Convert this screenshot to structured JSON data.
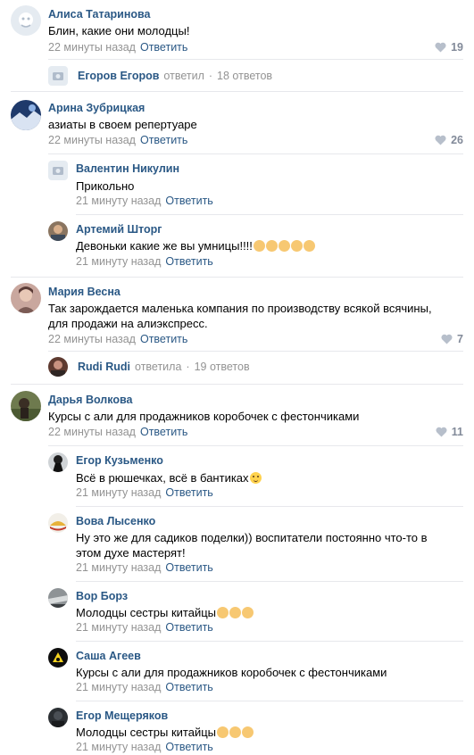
{
  "reply_label": "Ответить",
  "colors": {
    "link": "#2a5885",
    "meta": "#939393",
    "likes": "#828a99",
    "divider": "#e7e8ec"
  },
  "comments": [
    {
      "name": "Алиса Татаринова",
      "text": "Блин, какие они молодцы!",
      "time": "22 минуты назад",
      "likes": "19"
    },
    {
      "name": "Арина Зубрицкая",
      "text": "азиаты в своем репертуаре",
      "time": "22 минуты назад",
      "likes": "26"
    },
    {
      "name": "Мария Весна",
      "text": "Так зарождается маленька компания по производству всякой всячины, для продажи на алиэкспресс.",
      "time": "22 минуты назад",
      "likes": "7"
    },
    {
      "name": "Дарья Волкова",
      "text": "Курсы с али для продажников коробочек с фестончиками",
      "time": "22 минуты назад",
      "likes": "11"
    }
  ],
  "replies": [
    {
      "name": "Валентин Никулин",
      "text": "Прикольно",
      "time": "21 минуту назад"
    },
    {
      "name": "Артемий Шторг",
      "text": "Девоньки какие же вы умницы!!!!",
      "time": "21 минуту назад",
      "emoji": "clapping-hands"
    },
    {
      "name": "Егор Кузьменко",
      "text": "Всё в рюшечках, всё в бантиках",
      "time": "21 минуту назад",
      "emoji": "smiling-face"
    },
    {
      "name": "Вова Лысенко",
      "text": "Ну это же для садиков поделки)) воспитатели постоянно что-то в этом духе мастерят!",
      "time": "21 минуту назад"
    },
    {
      "name": "Вор Борз",
      "text": "Молодцы сестры китайцы",
      "time": "21 минуту назад",
      "emoji": "thumbs-up"
    },
    {
      "name": "Саша Агеев",
      "text": "Курсы с али для продажников коробочек с фестончиками",
      "time": "21 минуту назад"
    },
    {
      "name": "Егор Мещеряков",
      "text": "Молодцы сестры китайцы",
      "time": "21 минуту назад",
      "emoji": "thumbs-up"
    }
  ],
  "summaries": [
    {
      "name": "Егоров Егоров",
      "action": "ответил",
      "count": "18 ответов"
    },
    {
      "name": "Rudi Rudi",
      "action": "ответила",
      "count": "19 ответов"
    }
  ]
}
